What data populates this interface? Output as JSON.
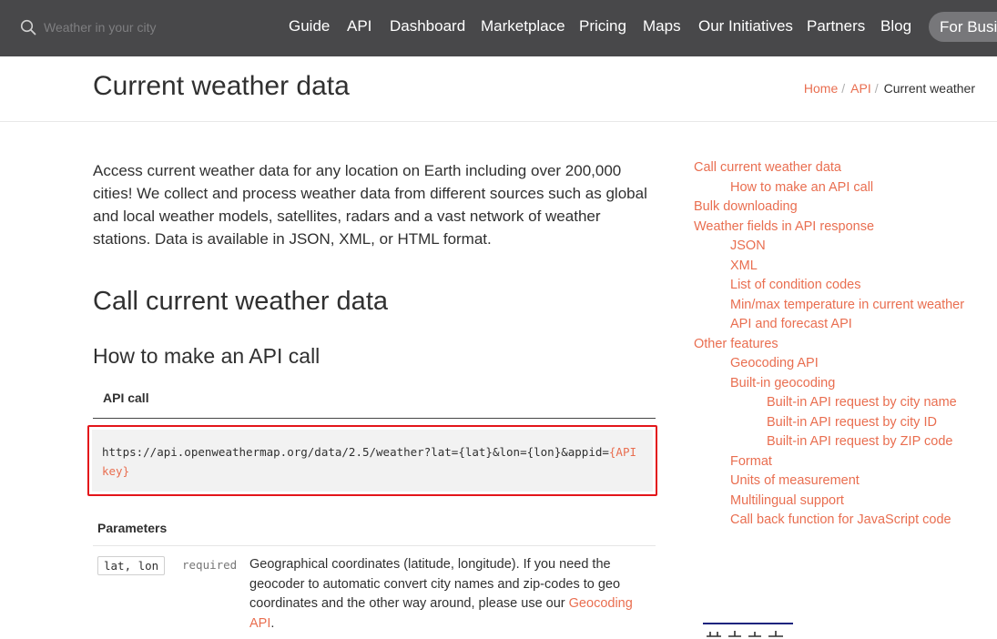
{
  "nav": {
    "search_placeholder": "Weather in your city",
    "items": [
      "Guide",
      "API",
      "Dashboard",
      "Marketplace",
      "Pricing",
      "Maps",
      "Our Initiatives",
      "Partners",
      "Blog"
    ],
    "cta": "For Business"
  },
  "header": {
    "title": "Current weather data",
    "breadcrumb": [
      "Home",
      "API",
      "Current weather"
    ]
  },
  "main": {
    "intro": "Access current weather data for any location on Earth including over 200,000 cities! We collect and process weather data from different sources such as global and local weather models, satellites, radars and a vast network of weather stations. Data is available in JSON, XML, or HTML format.",
    "section_title": "Call current weather data",
    "subsection_title": "How to make an API call",
    "api_call_label": "API call",
    "code_prefix": "https://api.openweathermap.org/data/2.5/weather?lat={lat}&lon={lon}&appid=",
    "code_key": "{API key}",
    "params_label": "Parameters",
    "params": [
      {
        "name": "lat, lon",
        "required": "required",
        "desc_text": "Geographical coordinates (latitude, longitude). If you need the geocoder to automatic convert city names and zip-codes to geo coordinates and the other way around, please use our ",
        "desc_link": "Geocoding API",
        "desc_end": "."
      }
    ]
  },
  "sidebar": {
    "toc": [
      {
        "label": "Call current weather data",
        "level": 1
      },
      {
        "label": "How to make an API call",
        "level": 2
      },
      {
        "label": "Bulk downloading",
        "level": 1
      },
      {
        "label": "Weather fields in API response",
        "level": 1
      },
      {
        "label": "JSON",
        "level": 2
      },
      {
        "label": "XML",
        "level": 2
      },
      {
        "label": "List of condition codes",
        "level": 2
      },
      {
        "label": "Min/max temperature in current weather",
        "level": 2
      },
      {
        "label": "API and forecast API",
        "level": 2
      },
      {
        "label": "Other features",
        "level": 1
      },
      {
        "label": "Geocoding API",
        "level": 2
      },
      {
        "label": "Built-in geocoding",
        "level": 2
      },
      {
        "label": "Built-in API request by city name",
        "level": 3
      },
      {
        "label": "Built-in API request by city ID",
        "level": 3
      },
      {
        "label": "Built-in API request by ZIP code",
        "level": 3
      },
      {
        "label": "Format",
        "level": 2
      },
      {
        "label": "Units of measurement",
        "level": 2
      },
      {
        "label": "Multilingual support",
        "level": 2
      },
      {
        "label": "Call back function for JavaScript code",
        "level": 2
      }
    ]
  },
  "colors": {
    "nav_bg": "#48484a",
    "accent_link": "#e96e50",
    "highlight_border": "#e3151a",
    "code_bg": "#f2f2f2"
  }
}
